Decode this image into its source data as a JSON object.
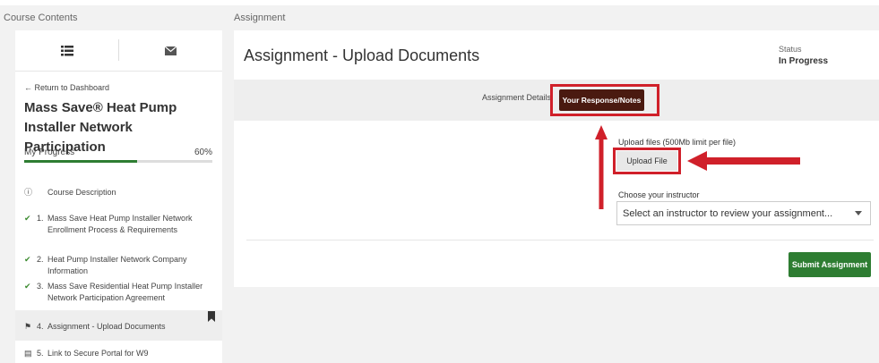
{
  "headers": {
    "left": "Course Contents",
    "right": "Assignment"
  },
  "sidebar": {
    "return_link": "← Return to Dashboard",
    "course_title": "Mass Save® Heat Pump Installer Network Participation",
    "progress_label": "My Progress",
    "progress_percent": "60%",
    "progress_value": 0.6,
    "items": [
      {
        "mark": "ⓘ",
        "num": "",
        "label": "Course Description"
      },
      {
        "mark": "✔",
        "num": "1.",
        "label": "Mass Save Heat Pump Installer Network Enrollment Process & Requirements"
      },
      {
        "mark": "✔",
        "num": "2.",
        "label": "Heat Pump Installer Network Company Information"
      },
      {
        "mark": "✔",
        "num": "3.",
        "label": "Mass Save Residential Heat Pump Installer Network Participation Agreement"
      },
      {
        "mark": "⚑",
        "num": "4.",
        "label": "Assignment - Upload Documents"
      },
      {
        "mark": "▤",
        "num": "5.",
        "label": "Link to Secure Portal for W9"
      }
    ]
  },
  "main": {
    "title": "Assignment - Upload Documents",
    "status_label": "Status",
    "status_value": "In Progress",
    "tabs": {
      "details": "Assignment Details",
      "response": "Your Response/Notes"
    },
    "upload_label": "Upload files (500Mb limit per file)",
    "upload_button": "Upload File",
    "instructor_label": "Choose your instructor",
    "instructor_select": "Select an instructor to review your assignment...",
    "submit_button": "Submit Assignment"
  },
  "colors": {
    "accent_green": "#2e7d32",
    "tab_active": "#4a1a10",
    "annotation_red": "#d0202a"
  }
}
